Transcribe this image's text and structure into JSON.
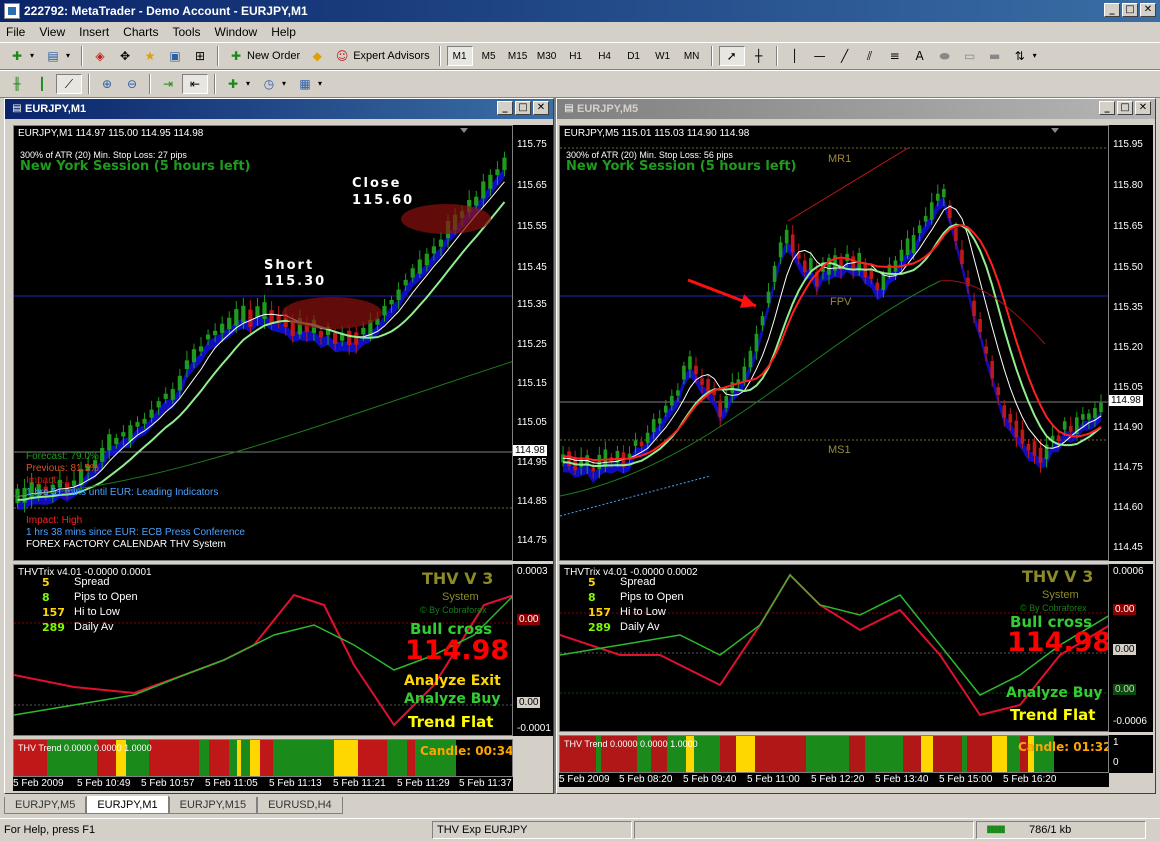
{
  "window": {
    "title": "222792: MetaTrader - Demo Account - EURJPY,M1",
    "min": "_",
    "max": "□",
    "close": "✕"
  },
  "menu": [
    "File",
    "View",
    "Insert",
    "Charts",
    "Tools",
    "Window",
    "Help"
  ],
  "toolbar": {
    "new_order": "New Order",
    "expert_advisors": "Expert Advisors",
    "timeframes": [
      "M1",
      "M5",
      "M15",
      "M30",
      "H1",
      "H4",
      "D1",
      "W1",
      "MN"
    ],
    "active_tf": "M1"
  },
  "left": {
    "title": "EURJPY,M1",
    "header": "EURJPY,M1  114.97 115.00 114.95 114.98",
    "atr": "300% of ATR (20)    Min. Stop Loss:  27 pips",
    "session": "New York Session (5 hours left)",
    "short_label": "Short",
    "short_price": "115.30",
    "close_label": "Close",
    "close_price": "115.60",
    "forecast": "Forecast: 79.0%",
    "previous": "Previous: 81.5%",
    "impact1": "Impact: ...",
    "leading": "1 hrs 51 mins until EUR: Leading Indicators",
    "impact2": "Impact: High",
    "since": "1 hrs 38 mins since EUR: ECB Press Conference",
    "calendar": "FOREX FACTORY CALENDAR THV System",
    "price_ticks": [
      "115.75",
      "115.65",
      "115.55",
      "115.45",
      "115.35",
      "115.25",
      "115.15",
      "115.05",
      "114.95",
      "114.85",
      "114.75"
    ],
    "last_price": "114.98",
    "trix_header": "THVTrix v4.01 -0.0000 0.0001",
    "stats": [
      {
        "value": "5",
        "label": "Spread",
        "color": "#ffd700"
      },
      {
        "value": "8",
        "label": "Pips to Open",
        "color": "#7cfc00"
      },
      {
        "value": "157",
        "label": "Hi to Low",
        "color": "#ffd700"
      },
      {
        "value": "289",
        "label": "Daily Av",
        "color": "#7cfc00"
      }
    ],
    "thv": "THV V 3",
    "system": "System",
    "by": "© By Cobraforex",
    "bull_cross": "Bull cross",
    "big_price": "114.98",
    "analyze_exit": "Analyze Exit",
    "analyze_buy": "Analyze Buy",
    "trend_flat": "Trend Flat",
    "trix_ticks": [
      "0.0003",
      "0.00",
      "0.00",
      "-0.0001"
    ],
    "trend_header": "THV Trend 0.0000 0.0000 1.0000",
    "candle": "Candle:  00:34",
    "time_labels": [
      "5 Feb 2009",
      "5 Feb 10:49",
      "5 Feb 10:57",
      "5 Feb 11:05",
      "5 Feb 11:13",
      "5 Feb 11:21",
      "5 Feb 11:29",
      "5 Feb 11:37"
    ]
  },
  "right": {
    "title": "EURJPY,M5",
    "header": "EURJPY,M5  115.01 115.03 114.90 114.98",
    "atr": "300% of ATR (20)    Min. Stop Loss:  56 pips",
    "session": "New York Session (5 hours left)",
    "mr1": "MR1",
    "fpv": "FPV",
    "ms1": "MS1",
    "price_ticks": [
      "115.95",
      "115.80",
      "115.65",
      "115.50",
      "115.35",
      "115.20",
      "115.05",
      "114.90",
      "114.75",
      "114.60",
      "114.45"
    ],
    "last_price": "114.98",
    "trix_header": "THVTrix v4.01 -0.0000 0.0002",
    "stats": [
      {
        "value": "5",
        "label": "Spread",
        "color": "#ffd700"
      },
      {
        "value": "8",
        "label": "Pips to Open",
        "color": "#7cfc00"
      },
      {
        "value": "157",
        "label": "Hi to Low",
        "color": "#ffd700"
      },
      {
        "value": "289",
        "label": "Daily Av",
        "color": "#7cfc00"
      }
    ],
    "thv": "THV V 3",
    "system": "System",
    "by": "© By Cobraforex",
    "bull_cross": "Bull cross",
    "big_price": "114.98",
    "analyze_buy": "Analyze Buy",
    "trend_flat": "Trend Flat",
    "trix_ticks": [
      "0.0006",
      "0.00",
      "0.00",
      "0.00",
      "-0.0006"
    ],
    "trend_header": "THV Trend 0.0000 0.0000 1.0000",
    "candle": "Candle:  01:32",
    "trend_ticks": [
      "1",
      "0"
    ],
    "time_labels": [
      "5 Feb 2009",
      "5 Feb 08:20",
      "5 Feb 09:40",
      "5 Feb 11:00",
      "5 Feb 12:20",
      "5 Feb 13:40",
      "5 Feb 15:00",
      "5 Feb 16:20"
    ]
  },
  "tabs": [
    "EURJPY,M5",
    "EURJPY,M1",
    "EURJPY,M15",
    "EURUSD,H4"
  ],
  "active_tab": "EURJPY,M1",
  "status": {
    "help": "For Help, press F1",
    "expert": "THV Exp EURJPY",
    "traffic": "786/1 kb"
  }
}
